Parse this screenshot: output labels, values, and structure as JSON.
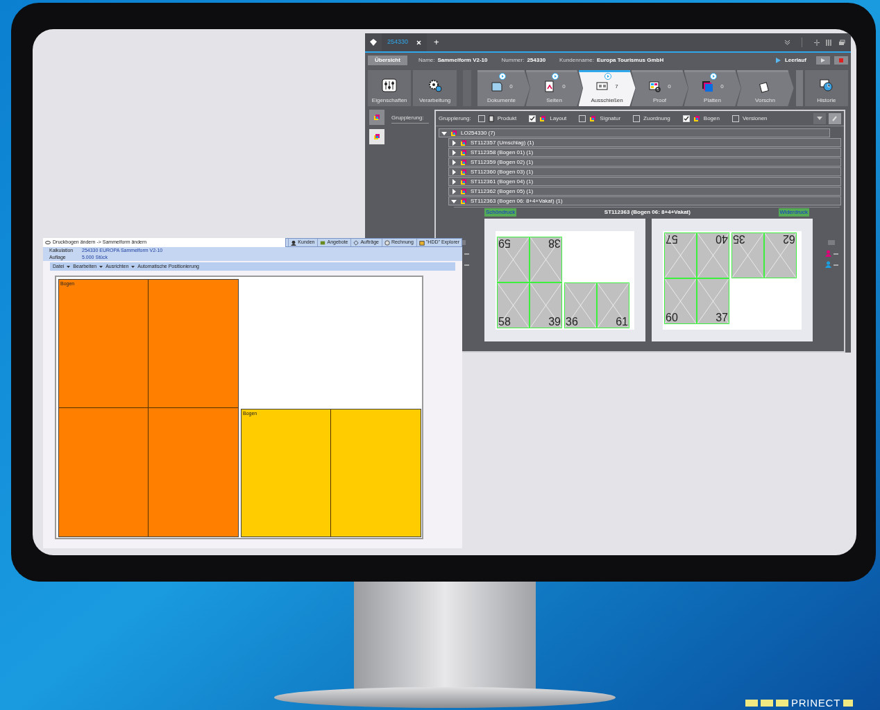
{
  "app_window": {
    "tabs": [
      {
        "label": "254330",
        "selected": true
      }
    ],
    "add_tab": "+",
    "overview_button": "Übersicht",
    "fields": [
      {
        "label": "Name:",
        "value": "Sammelform V2-10"
      },
      {
        "label": "Nummer:",
        "value": "254330"
      },
      {
        "label": "Kundenname:",
        "value": "Europa Tourismus GmbH"
      }
    ],
    "status": "Leerlauf",
    "tools": [
      "Eigenschaften",
      "Verarbeitung"
    ],
    "steps": [
      {
        "label": "Dokumente",
        "count": "0",
        "play": true,
        "selected": false
      },
      {
        "label": "Seiten",
        "count": "0",
        "play": true,
        "selected": false
      },
      {
        "label": "Ausschießen",
        "count": "7",
        "play": true,
        "selected": true
      },
      {
        "label": "Proof",
        "count": "0",
        "play": false,
        "selected": false
      },
      {
        "label": "Platten",
        "count": "0",
        "play": true,
        "selected": false
      },
      {
        "label": "Vorschn",
        "play": false,
        "selected": false
      }
    ],
    "history_button": "Historie",
    "side_label": "Gruppierung:",
    "grouping_label": "Gruppierung:",
    "grouping": [
      {
        "label": "Produkt",
        "checked": false
      },
      {
        "label": "Layout",
        "checked": true
      },
      {
        "label": "Signatur",
        "checked": false
      },
      {
        "label": "Zuordnung",
        "checked": false
      },
      {
        "label": "Bogen",
        "checked": true
      },
      {
        "label": "Versionen",
        "checked": false
      }
    ],
    "tree": {
      "label": "LO254330 (7)",
      "expanded": true,
      "children": [
        {
          "label": "ST112357 (Umschlag) (1)",
          "expanded": false
        },
        {
          "label": "ST112358 (Bogen 01) (1)",
          "expanded": false
        },
        {
          "label": "ST112359 (Bogen 02) (1)",
          "expanded": false
        },
        {
          "label": "ST112360 (Bogen 03) (1)",
          "expanded": false
        },
        {
          "label": "ST112361 (Bogen 04) (1)",
          "expanded": false
        },
        {
          "label": "ST112362 (Bogen 05) (1)",
          "expanded": false
        },
        {
          "label": "ST112363 (Bogen 06: 8+4+Vakat) (1)",
          "expanded": true
        }
      ]
    },
    "sheet_title": "ST112363 (Bogen 06: 8+4+Vakat)",
    "sides": [
      {
        "label": "Schöndruck",
        "blocks": [
          [
            {
              "number": "59",
              "flipped": true
            },
            {
              "number": "38",
              "flipped": true
            },
            {
              "number": "58",
              "flipped": false
            },
            {
              "number": "39",
              "flipped": false
            }
          ],
          [
            {
              "number": "36",
              "flipped": false
            },
            {
              "number": "61",
              "flipped": false
            }
          ]
        ]
      },
      {
        "label": "Widerdruck",
        "blocks": [
          [
            {
              "number": "57",
              "flipped": true
            },
            {
              "number": "40",
              "flipped": true
            },
            {
              "number": "60",
              "flipped": false
            },
            {
              "number": "37",
              "flipped": false
            }
          ],
          [
            {
              "number": "35",
              "flipped": true
            },
            {
              "number": "62",
              "flipped": true
            }
          ]
        ]
      }
    ]
  },
  "editor_window": {
    "title": "Druckbogen ändern -> Sammelform ändern",
    "toolbar": [
      "Kunden",
      "Angebote",
      "Aufträge",
      "Rechnung",
      "\"HDD\" Explorer"
    ],
    "info": [
      {
        "label": "Kalkulation",
        "value": "254330 EUROPA Sammelform V2-10"
      },
      {
        "label": "Auflage",
        "value": "5.000 Stück"
      }
    ],
    "menu": [
      "Datei",
      "Bearbeiten",
      "Ausrichten",
      "Automatische Positionierung"
    ],
    "sheets": [
      {
        "label": "Bogen",
        "color": "#ff8000"
      },
      {
        "label": "Bogen",
        "color": "#ffcc00"
      }
    ]
  },
  "logo": "PRINECT"
}
